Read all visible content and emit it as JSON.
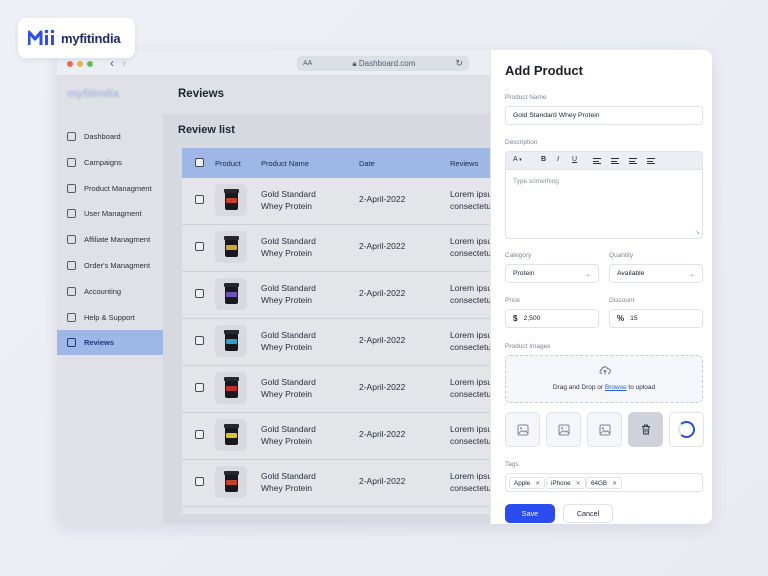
{
  "brand": {
    "name": "myfitindia"
  },
  "browser": {
    "text_size_label": "AA",
    "url": "Dashboard.com"
  },
  "sidebar": {
    "items": [
      {
        "label": "Dashboard",
        "icon": "grid-icon",
        "active": false
      },
      {
        "label": "Campaigns",
        "icon": "campaign-icon",
        "active": false
      },
      {
        "label": "Product Managment",
        "icon": "product-icon",
        "active": false
      },
      {
        "label": "User Managment",
        "icon": "user-icon",
        "active": false
      },
      {
        "label": "Affiliate Managment",
        "icon": "link-icon",
        "active": false
      },
      {
        "label": "Order's Managment",
        "icon": "order-icon",
        "active": false
      },
      {
        "label": "Accounting",
        "icon": "chart-icon",
        "active": false
      },
      {
        "label": "Help & Support",
        "icon": "help-icon",
        "active": false
      },
      {
        "label": "Reviews",
        "icon": "reviews-icon",
        "active": true
      }
    ]
  },
  "main": {
    "title": "Reviews",
    "panel_title": "Review list",
    "columns": [
      "Product",
      "Product Name",
      "Date",
      "Reviews"
    ],
    "rows": [
      {
        "name1": "Gold Standard",
        "name2": "Whey Protein",
        "date": "2-April-2022",
        "rev1": "Lorem ipsum",
        "rev2": "consectetur",
        "label_color": "#d4452b"
      },
      {
        "name1": "Gold Standard",
        "name2": "Whey Protein",
        "date": "2-April-2022",
        "rev1": "Lorem ipsum",
        "rev2": "consectetur",
        "label_color": "#d9b43a"
      },
      {
        "name1": "Gold Standard",
        "name2": "Whey Protein",
        "date": "2-April-2022",
        "rev1": "Lorem ipsum",
        "rev2": "consectetur",
        "label_color": "#7b54c8"
      },
      {
        "name1": "Gold Standard",
        "name2": "Whey Protein",
        "date": "2-April-2022",
        "rev1": "Lorem ipsum",
        "rev2": "consectetur",
        "label_color": "#3aa7d6"
      },
      {
        "name1": "Gold Standard",
        "name2": "Whey Protein",
        "date": "2-April-2022",
        "rev1": "Lorem ipsum",
        "rev2": "consectetur",
        "label_color": "#c8322a"
      },
      {
        "name1": "Gold Standard",
        "name2": "Whey Protein",
        "date": "2-April-2022",
        "rev1": "Lorem ipsum",
        "rev2": "consectetur",
        "label_color": "#e0d23a"
      },
      {
        "name1": "Gold Standard",
        "name2": "Whey Protein",
        "date": "2-April-2022",
        "rev1": "Lorem ipsum",
        "rev2": "consectetur",
        "label_color": "#d4452b"
      }
    ]
  },
  "form": {
    "title": "Add Product",
    "product_name_label": "Product Name",
    "product_name_value": "Gold Standard Whey Protein",
    "description_label": "Description",
    "toolbar": {
      "font": "A",
      "bold": "B",
      "italic": "I",
      "underline": "U"
    },
    "description_placeholder": "Type something",
    "category_label": "Category",
    "category_value": "Protein",
    "quantity_label": "Quantity",
    "quantity_value": "Available",
    "price_label": "Price",
    "price_prefix": "$",
    "price_value": "2,500",
    "discount_label": "Discount",
    "discount_prefix": "%",
    "discount_value": "15",
    "images_label": "Product Images",
    "dropzone_text": "Drag and Drop or",
    "dropzone_link": "Browse",
    "dropzone_suffix": "to upload",
    "tags_label": "Tags",
    "tags": [
      "Apple",
      "iPhone",
      "64GB"
    ],
    "save_label": "Save",
    "cancel_label": "Cancel"
  },
  "colors": {
    "accent": "#2a4cf0",
    "table_header": "#a8c3f5",
    "brand": "#1d2a6b"
  }
}
